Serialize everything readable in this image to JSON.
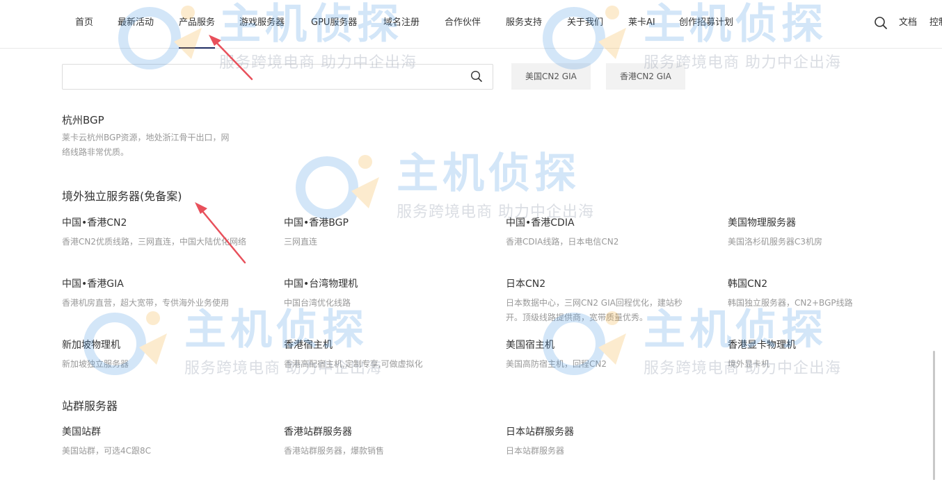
{
  "nav": {
    "items": [
      {
        "label": "首页"
      },
      {
        "label": "最新活动"
      },
      {
        "label": "产品服务",
        "active": true
      },
      {
        "label": "游戏服务器"
      },
      {
        "label": "GPU服务器"
      },
      {
        "label": "域名注册"
      },
      {
        "label": "合作伙伴"
      },
      {
        "label": "服务支持"
      },
      {
        "label": "关于我们"
      },
      {
        "label": "莱卡AI"
      },
      {
        "label": "创作招募计划"
      }
    ],
    "search_icon": "search-icon",
    "docs_label": "文档",
    "console_label": "控制"
  },
  "search": {
    "value": "",
    "placeholder": ""
  },
  "tags": [
    "美国CN2 GIA",
    "香港CN2 GIA"
  ],
  "hangzhou": {
    "name": "杭州BGP",
    "desc": "莱卡云杭州BGP资源，地处浙江骨干出口，网络线路非常优质。"
  },
  "sections": [
    {
      "title": "境外独立服务器(免备案)",
      "products": [
        {
          "name": "中国•香港CN2",
          "desc": "香港CN2优质线路，三网直连，中国大陆优化网络"
        },
        {
          "name": "中国•香港BGP",
          "desc": "三网直连"
        },
        {
          "name": "中国•香港CDIA",
          "desc": "香港CDIA线路，日本电信CN2"
        },
        {
          "name": "美国物理服务器",
          "desc": "美国洛杉矶服务器C3机房"
        },
        {
          "name": "中国•香港GIA",
          "desc": "香港机房直营，超大宽带，专供海外业务使用"
        },
        {
          "name": "中国•台湾物理机",
          "desc": "中国台湾优化线路"
        },
        {
          "name": "日本CN2",
          "desc": "日本数据中心，三网CN2 GIA回程优化，建站秒开。顶级线路提供商，宽带质量优秀。"
        },
        {
          "name": "韩国CN2",
          "desc": "韩国独立服务器，CN2+BGP线路"
        },
        {
          "name": "新加坡物理机",
          "desc": "新加坡独立服务器"
        },
        {
          "name": "香港宿主机",
          "desc": "香港高配宿主机,定制专享,可做虚拟化"
        },
        {
          "name": "美国宿主机",
          "desc": "美国高防宿主机，回程CN2"
        },
        {
          "name": "香港显卡物理机",
          "desc": "境外显卡机"
        }
      ]
    },
    {
      "title": "站群服务器",
      "products": [
        {
          "name": "美国站群",
          "desc": "美国站群，可选4C跟8C"
        },
        {
          "name": "香港站群服务器",
          "desc": "香港站群服务器，爆款销售"
        },
        {
          "name": "日本站群服务器",
          "desc": "日本站群服务器"
        }
      ]
    }
  ],
  "watermark": {
    "logo_text": "主机侦探",
    "tagline": "服务跨境电商 助力中企出海"
  },
  "colors": {
    "accent_underline": "#1f2d63",
    "annotation_arrow": "#e8505b",
    "watermark_blue": "#3b8fe0",
    "watermark_orange": "#f5a623"
  }
}
